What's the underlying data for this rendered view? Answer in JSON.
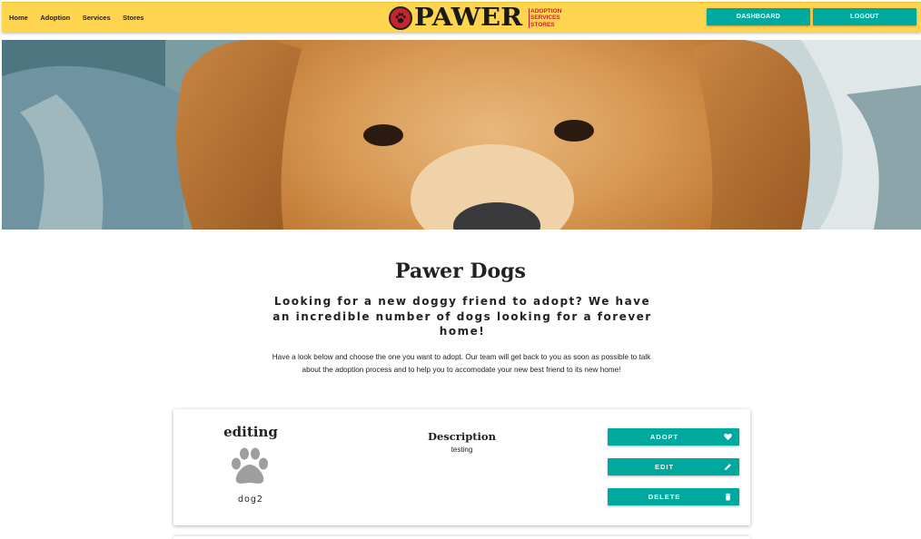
{
  "nav": {
    "links": [
      "Home",
      "Adoption",
      "Services",
      "Stores"
    ],
    "logo_text": "PAWER",
    "logo_sub": [
      "ADOPTION",
      "SERVICES",
      "STORES"
    ],
    "dashboard_label": "DASHBOARD",
    "logout_label": "LOGOUT"
  },
  "main": {
    "title": "Pawer Dogs",
    "subtitle": "Looking for a new doggy friend to adopt? We have an incredible number of dogs looking for a forever home!",
    "intro": "Have a look below and choose the one you want to adopt. Our team will get back to you as soon as possible to talk about the adoption process and to help you to accomodate your new best friend to its new home!"
  },
  "card": {
    "name": "editing",
    "breed": "dog2",
    "description_title": "Description",
    "description_text": "testing",
    "adopt_label": "ADOPT",
    "edit_label": "EDIT",
    "delete_label": "DELETE"
  },
  "colors": {
    "navbar": "#ffd550",
    "accent": "#00a99d",
    "logo_red": "#c8242b"
  },
  "icons": [
    "paw-icon",
    "heart-icon",
    "pencil-icon",
    "trash-icon"
  ]
}
